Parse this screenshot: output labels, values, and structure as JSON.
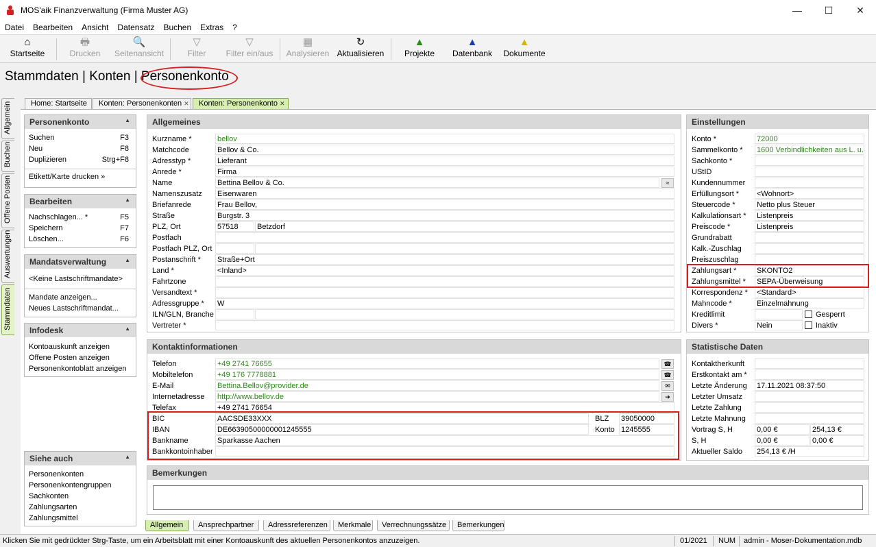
{
  "window": {
    "title": "MOS'aik Finanzverwaltung (Firma Muster AG)",
    "minimize": "—",
    "maximize": "☐",
    "close": "✕"
  },
  "menu": [
    "Datei",
    "Bearbeiten",
    "Ansicht",
    "Datensatz",
    "Buchen",
    "Extras",
    "?"
  ],
  "toolbar": [
    {
      "label": "Startseite",
      "icon": "home-icon",
      "glyph": "⌂",
      "enabled": true
    },
    {
      "label": "Drucken",
      "icon": "printer-icon",
      "glyph": "🖶",
      "enabled": false
    },
    {
      "label": "Seitenansicht",
      "icon": "preview-icon",
      "glyph": "🔍",
      "enabled": false
    },
    {
      "label": "Filter",
      "icon": "filter-icon",
      "glyph": "▽",
      "enabled": false
    },
    {
      "label": "Filter ein/aus",
      "icon": "filter-toggle-icon",
      "glyph": "▽",
      "enabled": false
    },
    {
      "label": "Analysieren",
      "icon": "analyze-icon",
      "glyph": "▦",
      "enabled": false
    },
    {
      "label": "Aktualisieren",
      "icon": "refresh-icon",
      "glyph": "↻",
      "enabled": true
    },
    {
      "label": "Projekte",
      "icon": "projects-icon",
      "glyph": "▲",
      "enabled": true
    },
    {
      "label": "Datenbank",
      "icon": "database-icon",
      "glyph": "▲",
      "enabled": true
    },
    {
      "label": "Dokumente",
      "icon": "documents-icon",
      "glyph": "▲",
      "enabled": true
    }
  ],
  "breadcrumb": "Stammdaten | Konten | Personenkonto",
  "vertical_tabs": [
    "Allgemein",
    "Buchen",
    "Offene Posten",
    "Auswertungen",
    "Stammdaten"
  ],
  "doc_tabs": [
    {
      "label": "Home: Startseite",
      "closable": false
    },
    {
      "label": "Konten: Personenkonten",
      "closable": true,
      "close": "✕"
    },
    {
      "label": "Konten: Personenkonto",
      "closable": true,
      "close": "✕"
    }
  ],
  "sidebar": {
    "personenkonto": {
      "title": "Personenkonto",
      "items": [
        {
          "label": "Suchen",
          "key": "F3"
        },
        {
          "label": "Neu",
          "key": "F8"
        },
        {
          "label": "Duplizieren",
          "key": "Strg+F8"
        }
      ],
      "extra": "Etikett/Karte drucken »"
    },
    "bearbeiten": {
      "title": "Bearbeiten",
      "items": [
        {
          "label": "Nachschlagen... *",
          "key": "F5"
        },
        {
          "label": "Speichern",
          "key": "F7"
        },
        {
          "label": "Löschen...",
          "key": "F6"
        }
      ]
    },
    "mandate": {
      "title": "Mandatsverwaltung",
      "first": "<Keine Lastschriftmandate>",
      "items": [
        "Mandate anzeigen...",
        "Neues Lastschriftmandat..."
      ]
    },
    "infodesk": {
      "title": "Infodesk",
      "items": [
        "Kontoauskunft anzeigen",
        "Offene Posten anzeigen",
        "Personenkontoblatt anzeigen"
      ]
    },
    "siehe": {
      "title": "Siehe auch",
      "items": [
        "Personenkonten",
        "Personenkontengruppen",
        "Sachkonten",
        "Zahlungsarten",
        "Zahlungsmittel"
      ]
    },
    "collapse": "▲"
  },
  "allgemein": {
    "title": "Allgemeines",
    "rows": [
      {
        "label": "Kurzname *",
        "value": "bellov",
        "green": true
      },
      {
        "label": "Matchcode",
        "value": "Bellov & Co."
      },
      {
        "label": "Adresstyp *",
        "value": "Lieferant"
      },
      {
        "label": "Anrede *",
        "value": "Firma"
      },
      {
        "label": "Name",
        "value": "Bettina Bellov & Co.",
        "btn": "≈"
      },
      {
        "label": "Namenszusatz",
        "value": "Eisenwaren"
      },
      {
        "label": "Briefanrede",
        "value": " Frau Bellov,"
      },
      {
        "label": "Straße",
        "value": "Burgstr. 3"
      },
      {
        "label": "PLZ, Ort",
        "value": "57518",
        "value2": "Betzdorf"
      },
      {
        "label": "Postfach",
        "value": ""
      },
      {
        "label": "Postfach PLZ, Ort",
        "value": "",
        "value2": ""
      },
      {
        "label": "Postanschrift *",
        "value": "Straße+Ort"
      },
      {
        "label": "Land *",
        "value": "<Inland>"
      },
      {
        "label": "Fahrtzone",
        "value": ""
      },
      {
        "label": "Versandtext *",
        "value": ""
      },
      {
        "label": "Adressgruppe *",
        "value": "W"
      },
      {
        "label": "ILN/GLN, Branche",
        "value": "",
        "value2": ""
      },
      {
        "label": "Vertreter *",
        "value": ""
      }
    ]
  },
  "einstellungen": {
    "title": "Einstellungen",
    "rows": [
      {
        "label": "Konto *",
        "value": "72000",
        "green": true
      },
      {
        "label": "Sammelkonto *",
        "value": "1600 Verbindlichkeiten aus L. u. L",
        "green": true
      },
      {
        "label": "Sachkonto *",
        "value": ""
      },
      {
        "label": "UStID",
        "value": ""
      },
      {
        "label": "Kundennummer",
        "value": ""
      },
      {
        "label": "Erfüllungsort *",
        "value": "<Wohnort>"
      },
      {
        "label": "Steuercode *",
        "value": "Netto plus Steuer"
      },
      {
        "label": "Kalkulationsart *",
        "value": "Listenpreis"
      },
      {
        "label": "Preiscode *",
        "value": "Listenpreis"
      },
      {
        "label": "Grundrabatt",
        "value": ""
      },
      {
        "label": "Kalk.-Zuschlag",
        "value": ""
      },
      {
        "label": "Preiszuschlag",
        "value": ""
      },
      {
        "label": "Zahlungsart *",
        "value": "SKONTO2"
      },
      {
        "label": "Zahlungsmittel *",
        "value": "SEPA-Überweisung"
      },
      {
        "label": "Korrespondenz *",
        "value": "<Standard>"
      },
      {
        "label": "Mahncode *",
        "value": "Einzelmahnung"
      },
      {
        "label": "Kreditlimit",
        "value": "",
        "check": "Gesperrt"
      },
      {
        "label": "Divers *",
        "value": "Nein",
        "check": "Inaktiv"
      }
    ]
  },
  "kontakt": {
    "title": "Kontaktinformationen",
    "rows": [
      {
        "label": "Telefon",
        "value": "+49 2741 76655",
        "green": true,
        "btn": "☎"
      },
      {
        "label": "Mobiltelefon",
        "value": "+49 176 7778881",
        "green": true,
        "btn": "☎"
      },
      {
        "label": "E-Mail",
        "value": "Bettina.Bellov@provider.de",
        "green": true,
        "btn": "✉"
      },
      {
        "label": "Internetadresse",
        "value": "http://www.bellov.de",
        "green": true,
        "btn": "➔"
      },
      {
        "label": "Telefax",
        "value": "+49 2741 76654"
      }
    ],
    "bank": [
      {
        "label": "BIC",
        "value": "AACSDE33XXX",
        "label2": "BLZ",
        "value2": "39050000"
      },
      {
        "label": "IBAN",
        "value": "DE66390500000001245555",
        "label2": "Konto",
        "value2": "1245555"
      },
      {
        "label": "Bankname",
        "value": "Sparkasse Aachen"
      },
      {
        "label": "Bankkontoinhaber",
        "value": ""
      }
    ]
  },
  "statistik": {
    "title": "Statistische Daten",
    "rows": [
      {
        "label": "Kontaktherkunft",
        "value": ""
      },
      {
        "label": "Erstkontakt am *",
        "value": ""
      },
      {
        "label": "Letzte Änderung",
        "value": "17.11.2021 08:37:50"
      },
      {
        "label": "Letzter Umsatz",
        "value": ""
      },
      {
        "label": "Letzte Zahlung",
        "value": ""
      },
      {
        "label": "Letzte Mahnung",
        "value": ""
      },
      {
        "label": "Vortrag S, H",
        "value": "0,00 €",
        "value2": "254,13 €"
      },
      {
        "label": "S, H",
        "value": "0,00 €",
        "value2": "0,00 €"
      },
      {
        "label": "Aktueller Saldo",
        "value": "254,13 € /H"
      }
    ]
  },
  "bemerkungen": {
    "title": "Bemerkungen",
    "value": ""
  },
  "bottom_tabs": [
    "Allgemein",
    "Ansprechpartner",
    "Adressreferenzen",
    "Merkmale",
    "Verrechnungssätze",
    "Bemerkungen"
  ],
  "status": {
    "message": "Klicken Sie mit gedrückter Strg-Taste, um ein Arbeitsblatt mit einer Kontoauskunft des aktuellen Personenkontos anzuzeigen.",
    "period": "01/2021",
    "num": "NUM",
    "db": "admin - Moser-Dokumentation.mdb"
  },
  "colors": {
    "accent_green": "#2e8a1a",
    "highlight_red": "#d42020",
    "active_tab": "#d6efb0"
  }
}
